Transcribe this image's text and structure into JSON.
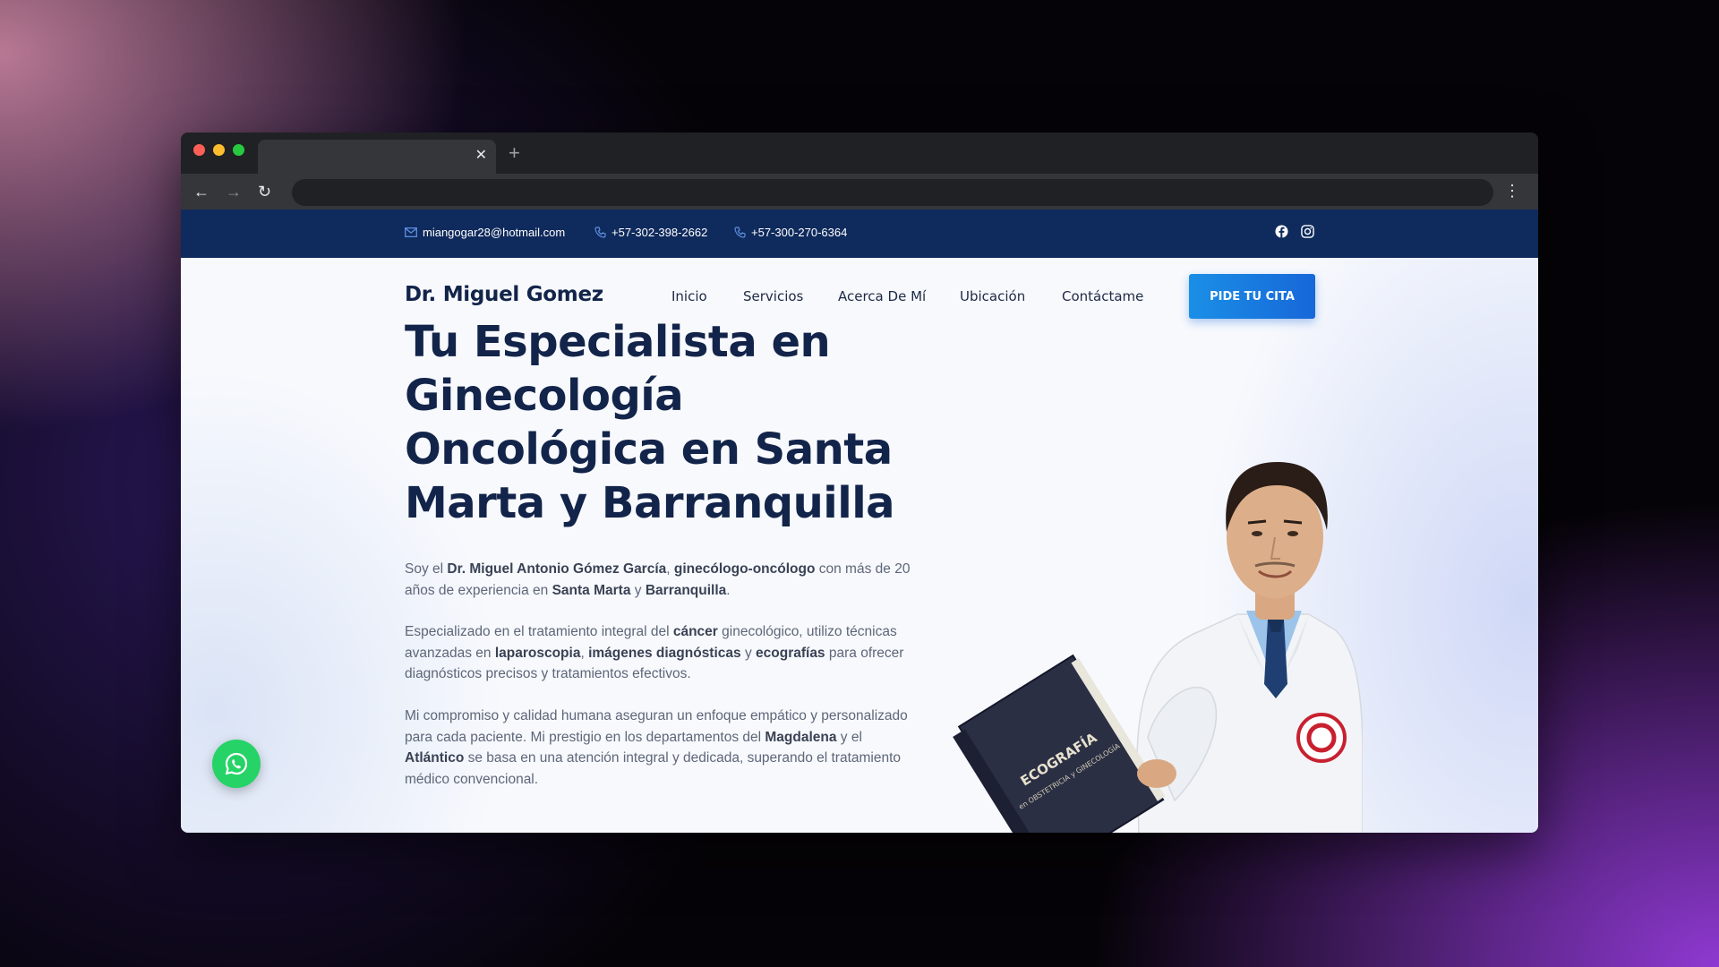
{
  "browser": {
    "close_glyph": "✕",
    "new_tab_glyph": "+",
    "back_glyph": "←",
    "forward_glyph": "→",
    "reload_glyph": "↻",
    "menu_glyph": "⋮"
  },
  "topbar": {
    "email": "miangogar28@hotmail.com",
    "phone1": "+57-302-398-2662",
    "phone2": "+57-300-270-6364",
    "social_icons": [
      "facebook-icon",
      "instagram-icon"
    ]
  },
  "header": {
    "logo": "Dr. Miguel Gomez",
    "nav": [
      "Inicio",
      "Servicios",
      "Acerca De Mí",
      "Ubicación",
      "Contáctame"
    ],
    "cta": "PIDE TU CITA"
  },
  "hero": {
    "title_lines": [
      "Tu Especialista en",
      "Ginecología",
      "Oncológica en Santa",
      "Marta y Barranquilla"
    ],
    "p1": {
      "t1": "Soy el ",
      "b1": "Dr. Miguel Antonio Gómez García",
      "t2": ", ",
      "b2": "ginecólogo-oncólogo",
      "t3": " con más de 20 años de experiencia en ",
      "b3": "Santa Marta",
      "t4": " y ",
      "b4": "Barranquilla",
      "t5": "."
    },
    "p2": {
      "t1": "Especializado en el tratamiento integral del ",
      "b1": "cáncer",
      "t2": " ginecológico, utilizo técnicas avanzadas en ",
      "b2": "laparoscopia",
      "t3": ", ",
      "b3": "imágenes diagnósticas",
      "t4": " y ",
      "b4": "ecografías",
      "t5": " para ofrecer diagnósticos precisos y tratamientos efectivos."
    },
    "p3": {
      "t1": "Mi compromiso y calidad humana aseguran un enfoque empático y personalizado para cada paciente. Mi prestigio en los departamentos del ",
      "b1": "Magdalena",
      "t2": " y el ",
      "b2": "Atlántico",
      "t3": " se basa en una atención integral y dedicada, superando el tratamiento médico convencional."
    },
    "book_title": "ECOGRAFÍA",
    "book_subtitle": "en OBSTETRICIA y GINECOLOGÍA"
  },
  "colors": {
    "topbar": "#0f2a5c",
    "heading": "#13244a",
    "cta": "#1767d8",
    "whatsapp": "#25d366"
  }
}
